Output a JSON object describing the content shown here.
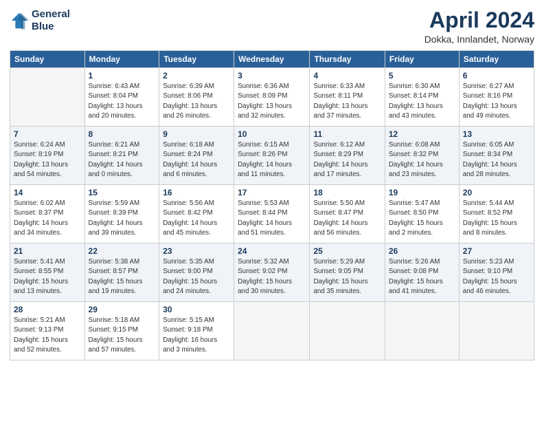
{
  "header": {
    "logo_line1": "General",
    "logo_line2": "Blue",
    "title": "April 2024",
    "subtitle": "Dokka, Innlandet, Norway"
  },
  "days_of_week": [
    "Sunday",
    "Monday",
    "Tuesday",
    "Wednesday",
    "Thursday",
    "Friday",
    "Saturday"
  ],
  "weeks": [
    [
      {
        "num": "",
        "info": ""
      },
      {
        "num": "1",
        "info": "Sunrise: 6:43 AM\nSunset: 8:04 PM\nDaylight: 13 hours\nand 20 minutes."
      },
      {
        "num": "2",
        "info": "Sunrise: 6:39 AM\nSunset: 8:06 PM\nDaylight: 13 hours\nand 26 minutes."
      },
      {
        "num": "3",
        "info": "Sunrise: 6:36 AM\nSunset: 8:09 PM\nDaylight: 13 hours\nand 32 minutes."
      },
      {
        "num": "4",
        "info": "Sunrise: 6:33 AM\nSunset: 8:11 PM\nDaylight: 13 hours\nand 37 minutes."
      },
      {
        "num": "5",
        "info": "Sunrise: 6:30 AM\nSunset: 8:14 PM\nDaylight: 13 hours\nand 43 minutes."
      },
      {
        "num": "6",
        "info": "Sunrise: 6:27 AM\nSunset: 8:16 PM\nDaylight: 13 hours\nand 49 minutes."
      }
    ],
    [
      {
        "num": "7",
        "info": "Sunrise: 6:24 AM\nSunset: 8:19 PM\nDaylight: 13 hours\nand 54 minutes."
      },
      {
        "num": "8",
        "info": "Sunrise: 6:21 AM\nSunset: 8:21 PM\nDaylight: 14 hours\nand 0 minutes."
      },
      {
        "num": "9",
        "info": "Sunrise: 6:18 AM\nSunset: 8:24 PM\nDaylight: 14 hours\nand 6 minutes."
      },
      {
        "num": "10",
        "info": "Sunrise: 6:15 AM\nSunset: 8:26 PM\nDaylight: 14 hours\nand 11 minutes."
      },
      {
        "num": "11",
        "info": "Sunrise: 6:12 AM\nSunset: 8:29 PM\nDaylight: 14 hours\nand 17 minutes."
      },
      {
        "num": "12",
        "info": "Sunrise: 6:08 AM\nSunset: 8:32 PM\nDaylight: 14 hours\nand 23 minutes."
      },
      {
        "num": "13",
        "info": "Sunrise: 6:05 AM\nSunset: 8:34 PM\nDaylight: 14 hours\nand 28 minutes."
      }
    ],
    [
      {
        "num": "14",
        "info": "Sunrise: 6:02 AM\nSunset: 8:37 PM\nDaylight: 14 hours\nand 34 minutes."
      },
      {
        "num": "15",
        "info": "Sunrise: 5:59 AM\nSunset: 8:39 PM\nDaylight: 14 hours\nand 39 minutes."
      },
      {
        "num": "16",
        "info": "Sunrise: 5:56 AM\nSunset: 8:42 PM\nDaylight: 14 hours\nand 45 minutes."
      },
      {
        "num": "17",
        "info": "Sunrise: 5:53 AM\nSunset: 8:44 PM\nDaylight: 14 hours\nand 51 minutes."
      },
      {
        "num": "18",
        "info": "Sunrise: 5:50 AM\nSunset: 8:47 PM\nDaylight: 14 hours\nand 56 minutes."
      },
      {
        "num": "19",
        "info": "Sunrise: 5:47 AM\nSunset: 8:50 PM\nDaylight: 15 hours\nand 2 minutes."
      },
      {
        "num": "20",
        "info": "Sunrise: 5:44 AM\nSunset: 8:52 PM\nDaylight: 15 hours\nand 8 minutes."
      }
    ],
    [
      {
        "num": "21",
        "info": "Sunrise: 5:41 AM\nSunset: 8:55 PM\nDaylight: 15 hours\nand 13 minutes."
      },
      {
        "num": "22",
        "info": "Sunrise: 5:38 AM\nSunset: 8:57 PM\nDaylight: 15 hours\nand 19 minutes."
      },
      {
        "num": "23",
        "info": "Sunrise: 5:35 AM\nSunset: 9:00 PM\nDaylight: 15 hours\nand 24 minutes."
      },
      {
        "num": "24",
        "info": "Sunrise: 5:32 AM\nSunset: 9:02 PM\nDaylight: 15 hours\nand 30 minutes."
      },
      {
        "num": "25",
        "info": "Sunrise: 5:29 AM\nSunset: 9:05 PM\nDaylight: 15 hours\nand 35 minutes."
      },
      {
        "num": "26",
        "info": "Sunrise: 5:26 AM\nSunset: 9:08 PM\nDaylight: 15 hours\nand 41 minutes."
      },
      {
        "num": "27",
        "info": "Sunrise: 5:23 AM\nSunset: 9:10 PM\nDaylight: 15 hours\nand 46 minutes."
      }
    ],
    [
      {
        "num": "28",
        "info": "Sunrise: 5:21 AM\nSunset: 9:13 PM\nDaylight: 15 hours\nand 52 minutes."
      },
      {
        "num": "29",
        "info": "Sunrise: 5:18 AM\nSunset: 9:15 PM\nDaylight: 15 hours\nand 57 minutes."
      },
      {
        "num": "30",
        "info": "Sunrise: 5:15 AM\nSunset: 9:18 PM\nDaylight: 16 hours\nand 3 minutes."
      },
      {
        "num": "",
        "info": ""
      },
      {
        "num": "",
        "info": ""
      },
      {
        "num": "",
        "info": ""
      },
      {
        "num": "",
        "info": ""
      }
    ]
  ]
}
